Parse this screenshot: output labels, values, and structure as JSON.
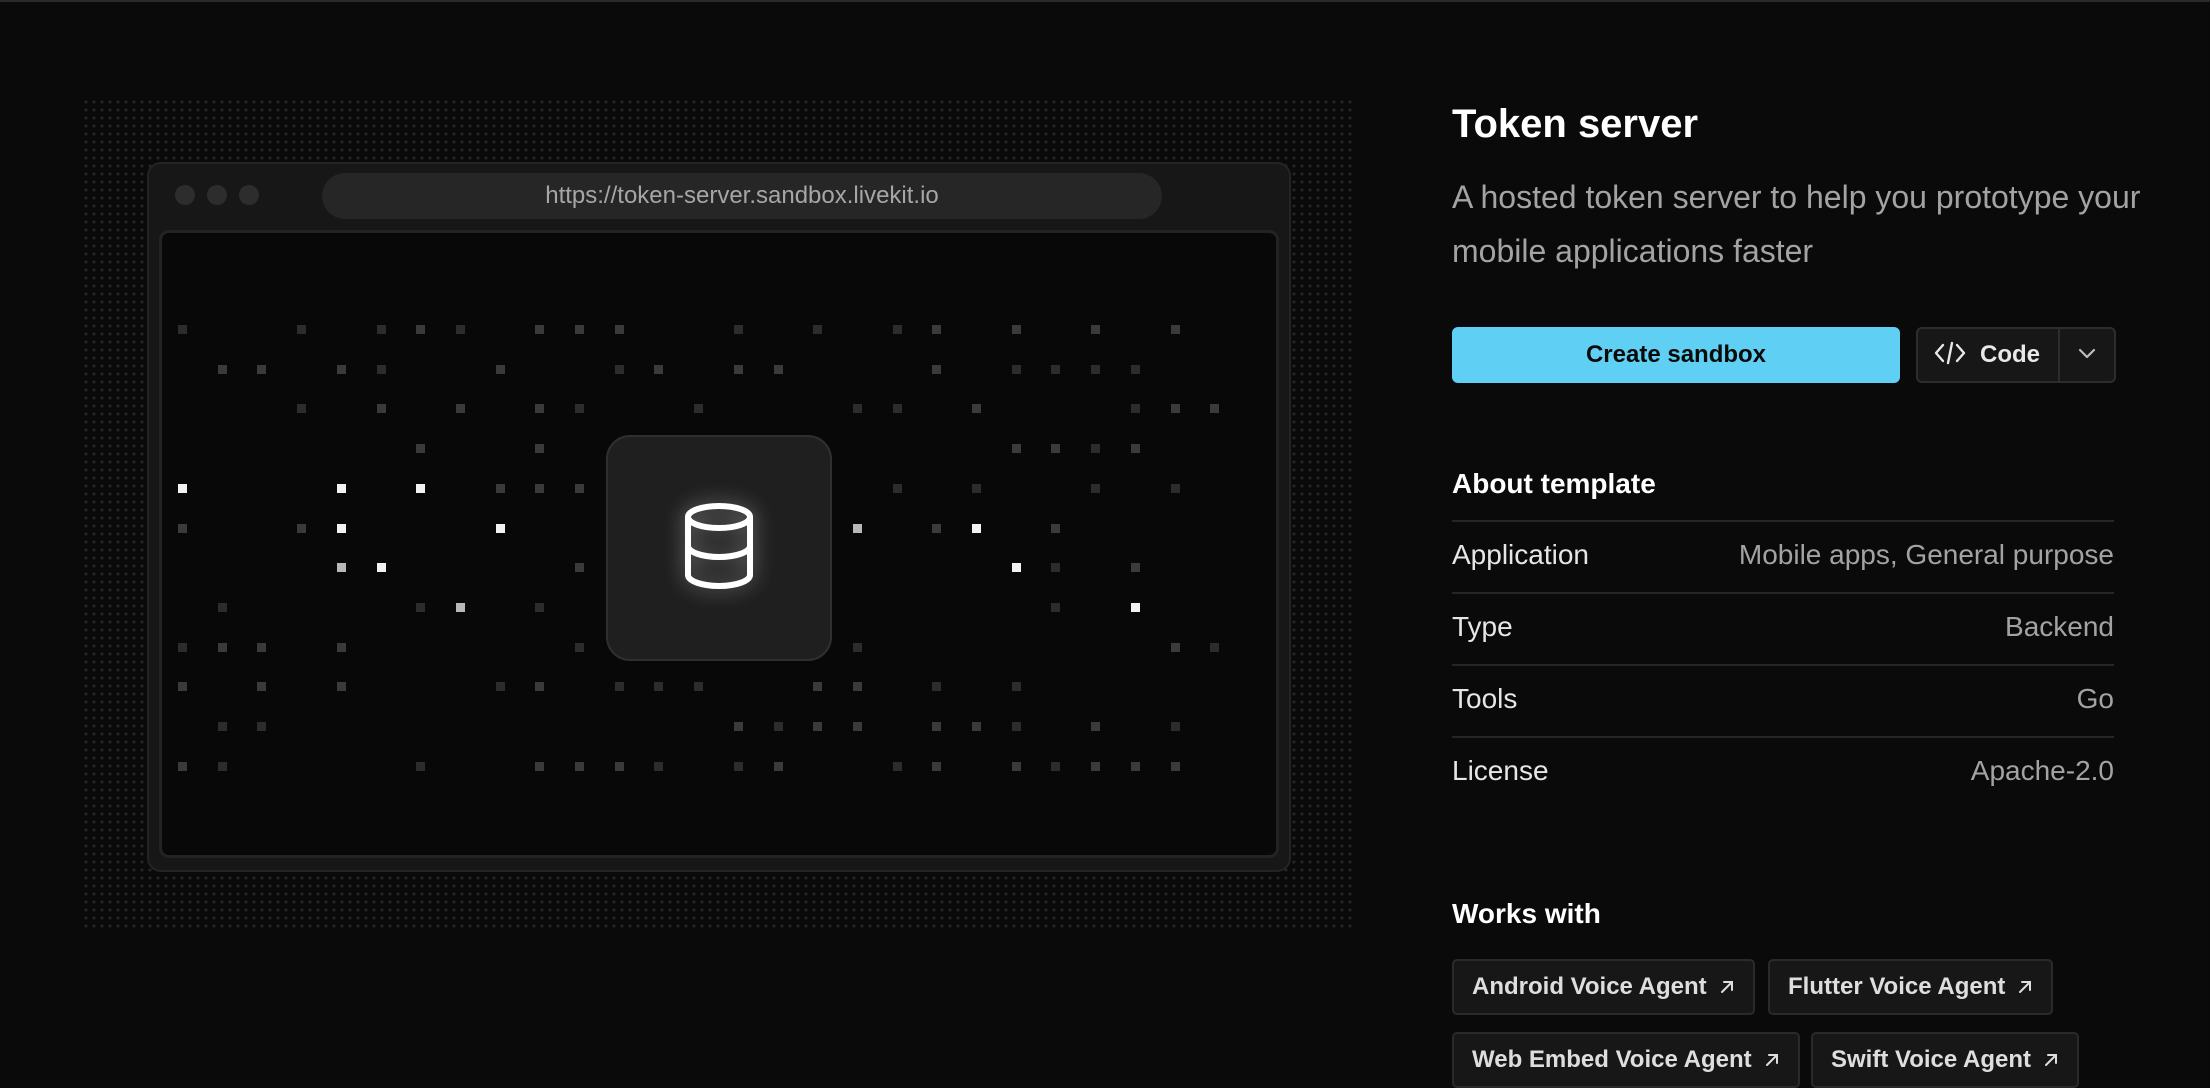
{
  "preview": {
    "url": "https://token-server.sandbox.livekit.io",
    "center_icon": "database-icon"
  },
  "template": {
    "title": "Token server",
    "description": "A hosted token server to help you prototype your mobile applications faster"
  },
  "actions": {
    "create_label": "Create sandbox",
    "code_label": "Code",
    "code_icon": "code-brackets-icon",
    "dropdown_icon": "chevron-down-icon"
  },
  "about": {
    "heading": "About template",
    "rows": [
      {
        "key": "Application",
        "value": "Mobile apps, General purpose"
      },
      {
        "key": "Type",
        "value": "Backend"
      },
      {
        "key": "Tools",
        "value": "Go"
      },
      {
        "key": "License",
        "value": "Apache-2.0"
      }
    ]
  },
  "works_with": {
    "heading": "Works with",
    "items": [
      {
        "label": "Android Voice Agent"
      },
      {
        "label": "Flutter Voice Agent"
      },
      {
        "label": "Web Embed Voice Agent"
      },
      {
        "label": "Swift Voice Agent"
      }
    ]
  },
  "colors": {
    "accent": "#5fd0f3",
    "background": "#0a0a0a"
  }
}
